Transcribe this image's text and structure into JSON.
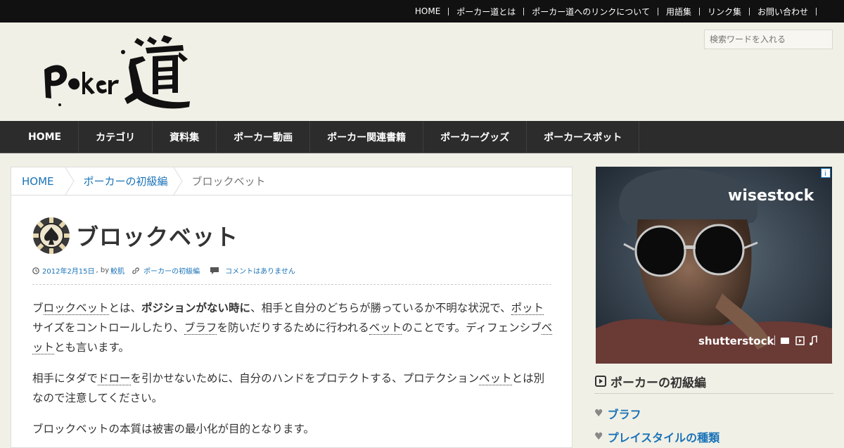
{
  "top_nav": {
    "items": [
      "HOME",
      "ポーカー道とは",
      "ポーカー道へのリンクについて",
      "用語集",
      "リンク集",
      "お問い合わせ"
    ]
  },
  "logo": {
    "alt": "Poker道"
  },
  "search": {
    "placeholder": "検索ワードを入れる"
  },
  "main_nav": {
    "items": [
      "HOME",
      "カテゴリ",
      "資料集",
      "ポーカー動画",
      "ポーカー関連書籍",
      "ポーカーグッズ",
      "ポーカースポット"
    ]
  },
  "breadcrumb": {
    "home": "HOME",
    "category": "ポーカーの初級編",
    "current": "ブロックベット"
  },
  "article": {
    "title": "ブロックベット",
    "date": "2012年2月15日",
    "by": ", by",
    "author": "鮫肌",
    "category": "ポーカーの初級編",
    "comments": "コメントはありません",
    "p1": {
      "a": "ブ",
      "b": "ロックベット",
      "c": "とは、",
      "d": "ポジションがない時に",
      "e": "、相手と自分のどちらが勝っているか不明な状況で、",
      "f": "ポット",
      "g": "サイズをコントロールしたり、",
      "h": "ブラフ",
      "i": "を防いだりするために行われる",
      "j": "ベット",
      "k": "のことです。ディフェンシブ",
      "l": "ベット",
      "m": "とも言います。"
    },
    "p2": {
      "a": "相手にタダで",
      "b": "ドロー",
      "c": "を引かせないために、自分のハンドをプロテクトする、プロテクション",
      "d": "ベット",
      "e": "とは別なので注意してください。"
    },
    "p3": "ブロックベットの本質は被害の最小化が目的となります。"
  },
  "ad": {
    "brand_top": "wisestock",
    "brand_bottom": "shutterstock"
  },
  "sidebar": {
    "widget_title": "ポーカーの初級編",
    "items": [
      "ブラフ",
      "プレイスタイルの種類"
    ]
  },
  "colors": {
    "link": "#1a73b8",
    "nav_bg": "#2c2c2c",
    "top_bg": "#111111",
    "page_bg": "#f1f0e6"
  }
}
